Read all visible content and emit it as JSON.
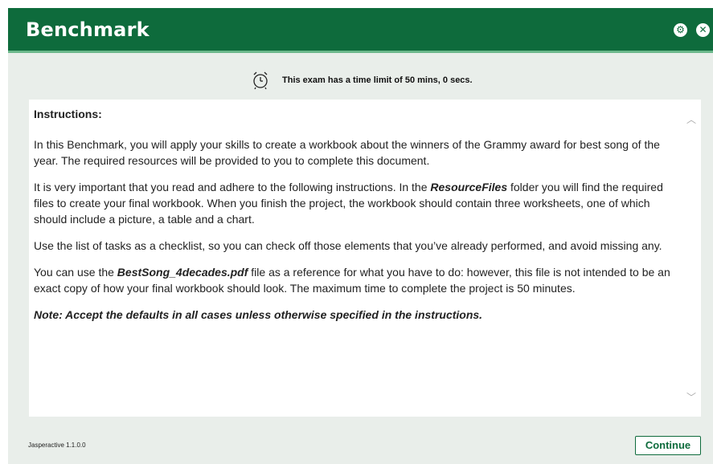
{
  "window": {
    "title": "Benchmark"
  },
  "timer": {
    "text": "This exam has a time limit of 50 mins, 0 secs."
  },
  "instructions": {
    "heading": "Instructions:",
    "p1": "In this Benchmark, you will apply your skills to create a workbook about the winners of the Grammy award for best song of the year. The required resources will be provided to you to complete this document.",
    "p2_a": "It is very important that you read and adhere to the following instructions. In the ",
    "p2_folder": "ResourceFiles",
    "p2_b": " folder you will find the required files to create your final workbook. When you finish the project, the workbook should contain three worksheets, one of which should include a picture, a table and a chart.",
    "p3": "Use the list of tasks as a checklist, so you can check off those elements that you’ve already performed, and avoid missing any.",
    "p4_a": "You can use the ",
    "p4_file": "BestSong_4decades.pdf",
    "p4_b": " file as a reference for what you have to do: however, this file is not intended to be an exact copy of how your final workbook should look. The maximum time to complete the project is 50 minutes.",
    "note": "Note: Accept the defaults in all cases unless otherwise specified in the instructions."
  },
  "footer": {
    "version": "Jasperactive 1.1.0.0",
    "continue_label": "Continue"
  },
  "colors": {
    "titlebar": "#0e6b3c",
    "accent": "#6bb88b"
  },
  "icons": {
    "settings": "gear-icon",
    "close": "close-icon",
    "timer": "alarm-clock-icon"
  }
}
